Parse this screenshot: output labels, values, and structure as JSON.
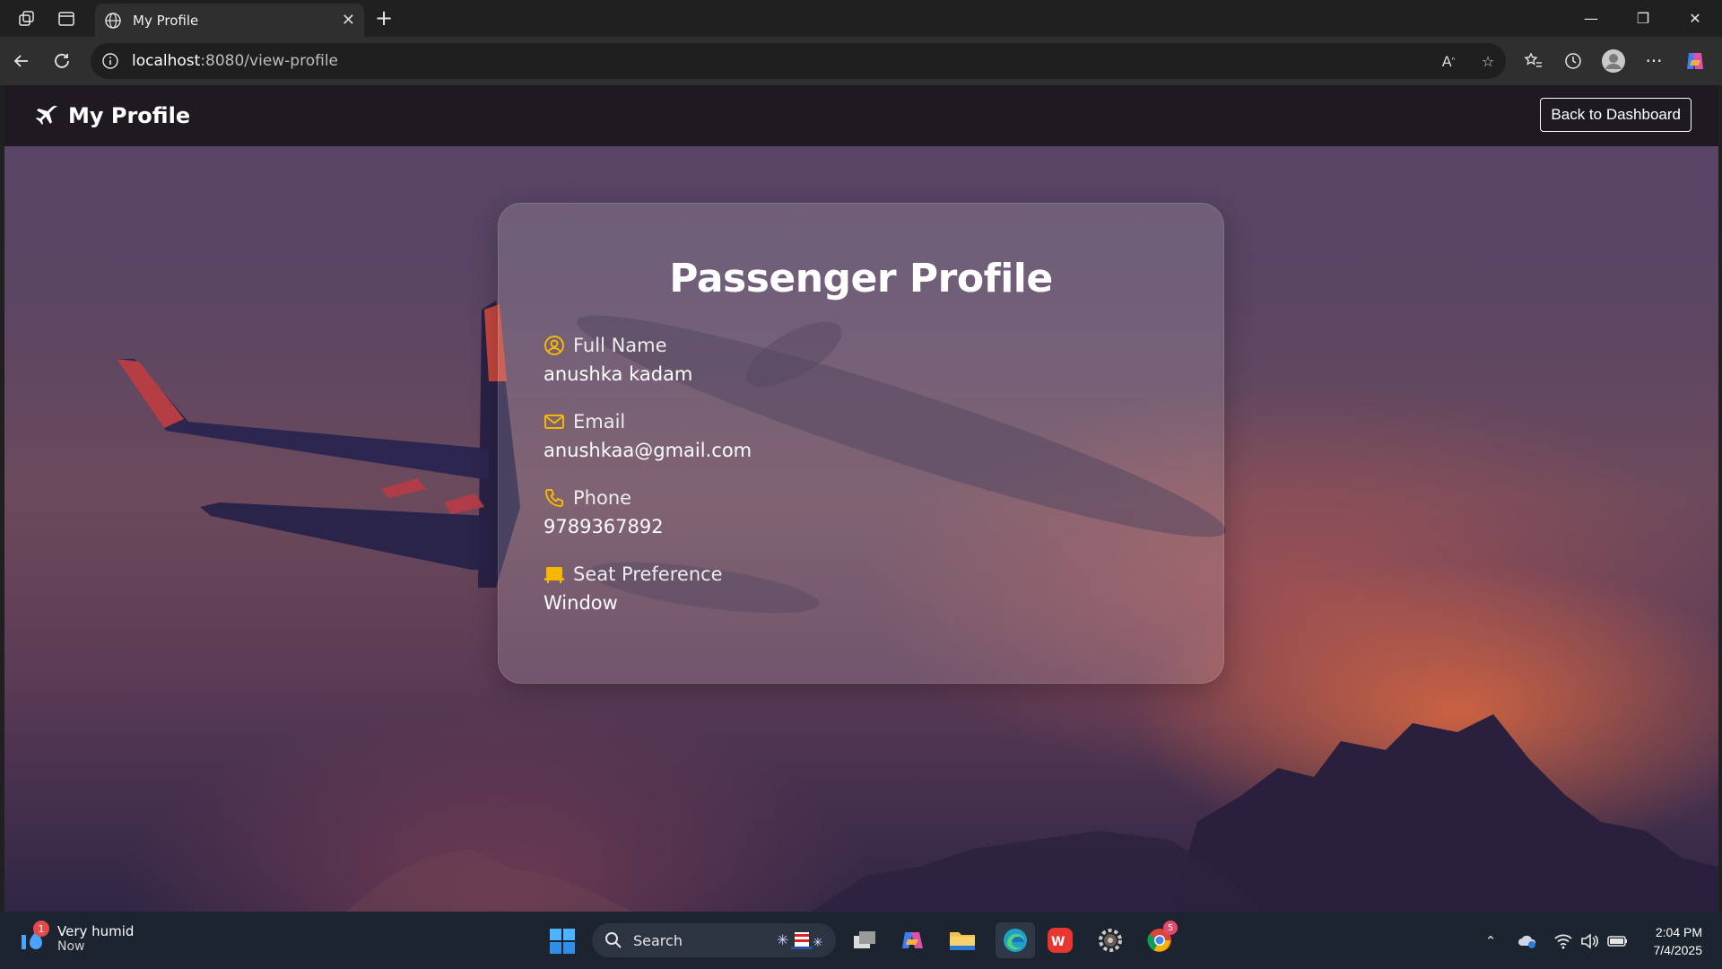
{
  "browser": {
    "tab_title": "My Profile",
    "url_host": "localhost",
    "url_path": ":8080/view-profile"
  },
  "page": {
    "brand_title": "My Profile",
    "back_button": "Back to Dashboard",
    "card_title": "Passenger Profile",
    "fields": [
      {
        "label": "Full Name",
        "value": "anushka kadam",
        "icon": "user-circle-icon"
      },
      {
        "label": "Email",
        "value": "anushkaa@gmail.com",
        "icon": "envelope-icon"
      },
      {
        "label": "Phone",
        "value": "9789367892",
        "icon": "phone-icon"
      },
      {
        "label": "Seat Preference",
        "value": "Window",
        "icon": "seat-icon"
      }
    ],
    "accent_color": "#f5b800"
  },
  "taskbar": {
    "weather_title": "Very humid",
    "weather_sub": "Now",
    "weather_badge": "1",
    "search_label": "Search",
    "chrome_badge": "5",
    "time": "2:04 PM",
    "date": "7/4/2025"
  }
}
